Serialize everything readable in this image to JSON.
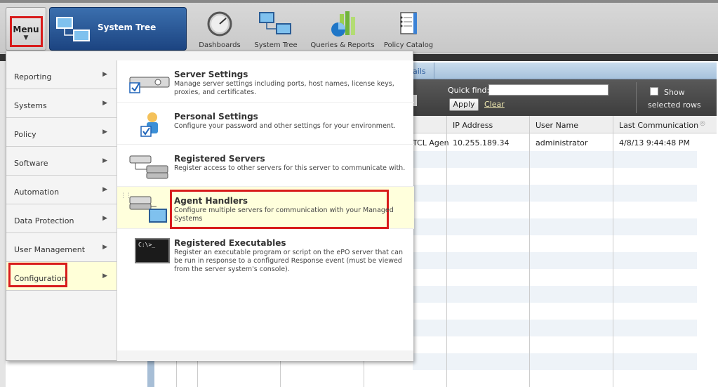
{
  "toolbar": {
    "menu_label": "Menu",
    "menu_arrow": "▼",
    "active_tab": "System Tree",
    "nav": [
      {
        "label": "Dashboards",
        "icon": "dashboard-gauge-icon"
      },
      {
        "label": "System Tree",
        "icon": "system-tree-icon"
      },
      {
        "label": "Queries & Reports",
        "icon": "queries-reports-chart-icon"
      },
      {
        "label": "Policy Catalog",
        "icon": "policy-catalog-icon"
      }
    ]
  },
  "background": {
    "tab_partial": "ails",
    "quick_find_label": "Quick find:",
    "quick_find_value": "",
    "apply_label": "Apply",
    "clear_label": "Clear",
    "show_label": "Show",
    "selected_rows_label": "selected rows",
    "columns": [
      "IP Address",
      "User Name",
      "Last Communication"
    ],
    "rows": [
      {
        "partial": "TCL Agen",
        "ip": "10.255.189.34",
        "user": "administrator",
        "last": "4/8/13 9:44:48 PM"
      }
    ]
  },
  "menu": {
    "categories": [
      {
        "label": "Reporting",
        "arrow": "▶"
      },
      {
        "label": "Systems",
        "arrow": "▶"
      },
      {
        "label": "Policy",
        "arrow": "▶"
      },
      {
        "label": "Software",
        "arrow": "▶"
      },
      {
        "label": "Automation",
        "arrow": "▶"
      },
      {
        "label": "Data Protection",
        "arrow": "▶"
      },
      {
        "label": "User Management",
        "arrow": "▶"
      },
      {
        "label": "Configuration",
        "arrow": "▶"
      }
    ],
    "selected_category": "Configuration",
    "items": [
      {
        "title": "Server Settings",
        "desc": "Manage server settings including ports, host names, license keys, proxies, and certificates.",
        "icon": "server-settings-icon"
      },
      {
        "title": "Personal Settings",
        "desc": "Configure your password and other settings for your environment.",
        "icon": "personal-settings-icon"
      },
      {
        "title": "Registered Servers",
        "desc": "Register access to other servers for this server to communicate with.",
        "icon": "registered-servers-icon"
      },
      {
        "title": "Agent Handlers",
        "desc": "Configure multiple servers for communication with your Managed Systems",
        "icon": "agent-handlers-icon"
      },
      {
        "title": "Registered Executables",
        "desc": "Register an executable program or script on the ePO server that can be run in response to a configured Response event (must be viewed from the server system's console).",
        "icon": "registered-executables-icon"
      }
    ],
    "selected_item": "Agent Handlers"
  },
  "colors": {
    "highlight": "#d81c1c",
    "selected_bg": "#ffffd8",
    "tab_blue": "#1c4481"
  }
}
